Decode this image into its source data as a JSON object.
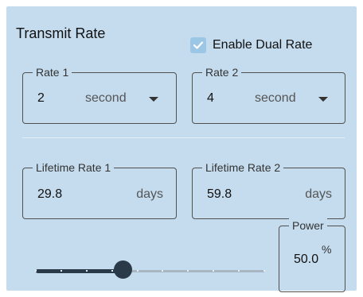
{
  "title": "Transmit Rate",
  "dual_rate": {
    "label": "Enable Dual Rate",
    "checked": true
  },
  "rate1": {
    "legend": "Rate 1",
    "value": "2",
    "unit": "second"
  },
  "rate2": {
    "legend": "Rate 2",
    "value": "4",
    "unit": "second"
  },
  "lifetime1": {
    "legend": "Lifetime Rate 1",
    "value": "29.8",
    "unit": "days"
  },
  "lifetime2": {
    "legend": "Lifetime Rate 2",
    "value": "59.8",
    "unit": "days"
  },
  "power": {
    "legend": "Power",
    "value": "50.0",
    "unit": "%"
  },
  "slider": {
    "value_fraction": 0.38,
    "steps": 9
  },
  "colors": {
    "panel": "#c5dcee",
    "accent": "#2a3a49",
    "checkbox": "#9cc6e6"
  }
}
